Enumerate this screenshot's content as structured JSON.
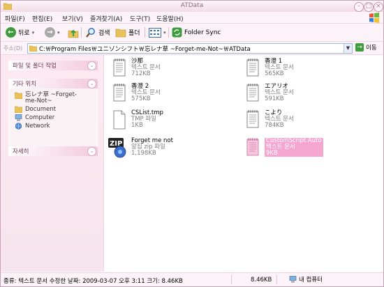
{
  "window": {
    "title": "ATData"
  },
  "menu": [
    "파일(F)",
    "편집(E)",
    "보기(V)",
    "즐겨찾기(A)",
    "도구(T)",
    "도움말(H)"
  ],
  "toolbar": {
    "back": "뒤로",
    "search": "검색",
    "folders": "폴더",
    "folder_sync": "Folder Sync"
  },
  "address": {
    "label": "주소(D)",
    "path": "C:￦Program Files￦ユニゾンシフト￦忘レナ草 ~Forget-me-Not~￦ATData",
    "go": "이동"
  },
  "sidebar": {
    "tasks_title": "파일 및 폴더 작업",
    "places_title": "기타 위치",
    "places": [
      {
        "label": "忘レナ草 ~Forget-me-Not~",
        "icon": "folder-icon"
      },
      {
        "label": "Document",
        "icon": "folder-icon"
      },
      {
        "label": "Computer",
        "icon": "computer-icon"
      },
      {
        "label": "Network",
        "icon": "network-icon"
      }
    ],
    "details_title": "자세히"
  },
  "files": [
    {
      "name": "沙那",
      "type": "텍스트 문서",
      "size": "712KB",
      "icon": "text-doc-icon",
      "selected": false
    },
    {
      "name": "香澄 1",
      "type": "텍스트 문서",
      "size": "565KB",
      "icon": "text-doc-icon",
      "selected": false
    },
    {
      "name": "香澄 2",
      "type": "텍스트 문서",
      "size": "575KB",
      "icon": "text-doc-icon",
      "selected": false
    },
    {
      "name": "エアリオ",
      "type": "텍스트 문서",
      "size": "591KB",
      "icon": "text-doc-icon",
      "selected": false
    },
    {
      "name": "CSList.tmp",
      "type": "TMP 파일",
      "size": "1KB",
      "icon": "tmp-file-icon",
      "selected": false
    },
    {
      "name": "こより",
      "type": "텍스트 문서",
      "size": "784KB",
      "icon": "text-doc-icon",
      "selected": false
    },
    {
      "name": "Forget me not",
      "type": "알집 zip 파일",
      "size": "1,198KB",
      "icon": "zip-archive-icon",
      "selected": false
    },
    {
      "name": "CustomScript.Auto",
      "type": "텍스트 문서",
      "size": "9KB",
      "icon": "text-doc-icon",
      "selected": true
    }
  ],
  "status": {
    "info": "종류: 텍스트 문서 수정한 날짜: 2009-03-07 오후 3:11 크기: 8.46KB",
    "size": "8.46KB",
    "location": "내 컴퓨터"
  },
  "colors": {
    "accent_pink": "#f4a6d0",
    "window_border": "#c8a2b8"
  }
}
